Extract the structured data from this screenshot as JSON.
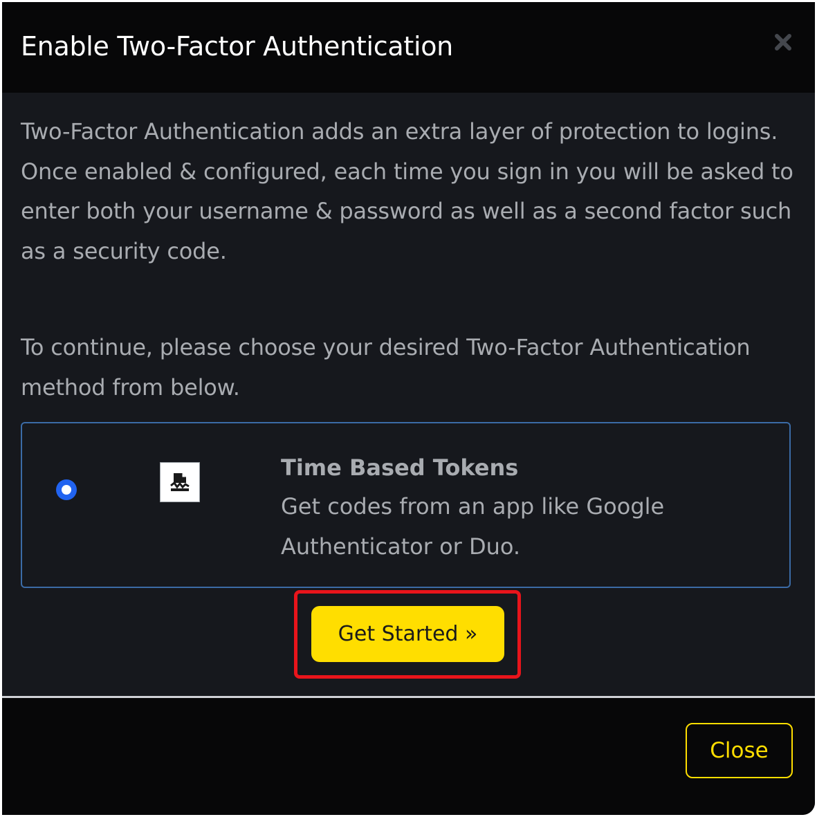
{
  "modal": {
    "title": "Enable Two-Factor Authentication",
    "close_icon": "close-icon"
  },
  "body": {
    "intro": "Two-Factor Authentication adds an extra layer of protection to logins. Once enabled & configured, each time you sign in you will be asked to enter both your username & password as well as a second factor such as a security code.",
    "instruction": "To continue, please choose your desired Two-Factor Authentication method from below."
  },
  "option": {
    "selected": true,
    "icon": "broken-image-icon",
    "title": "Time Based Tokens",
    "description": "Get codes from an app like Google Authenticator or Duo."
  },
  "actions": {
    "get_started_label": "Get Started »"
  },
  "footer": {
    "close_label": "Close"
  },
  "colors": {
    "accent": "#ffde00",
    "radio": "#2163f0",
    "option_border": "#3b6ba6",
    "highlight": "#e8141b",
    "background": "#16181d",
    "header_background": "#070708"
  }
}
